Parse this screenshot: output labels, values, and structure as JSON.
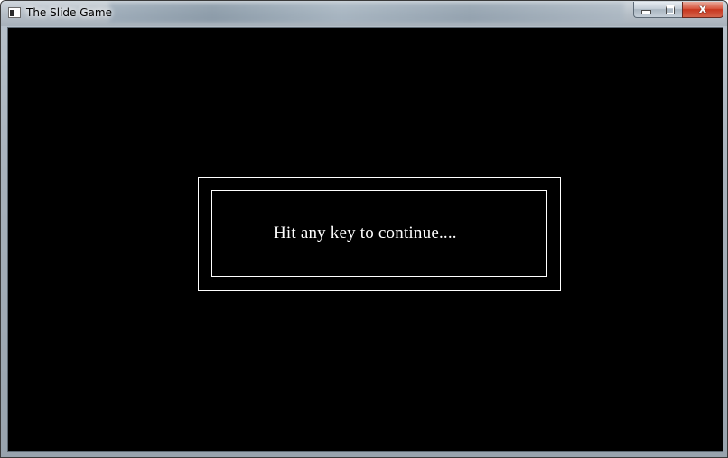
{
  "window": {
    "title": "The Slide Game",
    "icon": "app-window-icon",
    "caption_buttons": {
      "minimize_icon": "minimize-icon",
      "maximize_icon": "maximize-icon",
      "close_glyph": "x"
    }
  },
  "game": {
    "background_color": "#000000",
    "foreground_color": "#ffffff",
    "prompt": "Hit any key to continue...."
  },
  "colors": {
    "close_button": "#c7361e",
    "client_background": "#000000"
  }
}
